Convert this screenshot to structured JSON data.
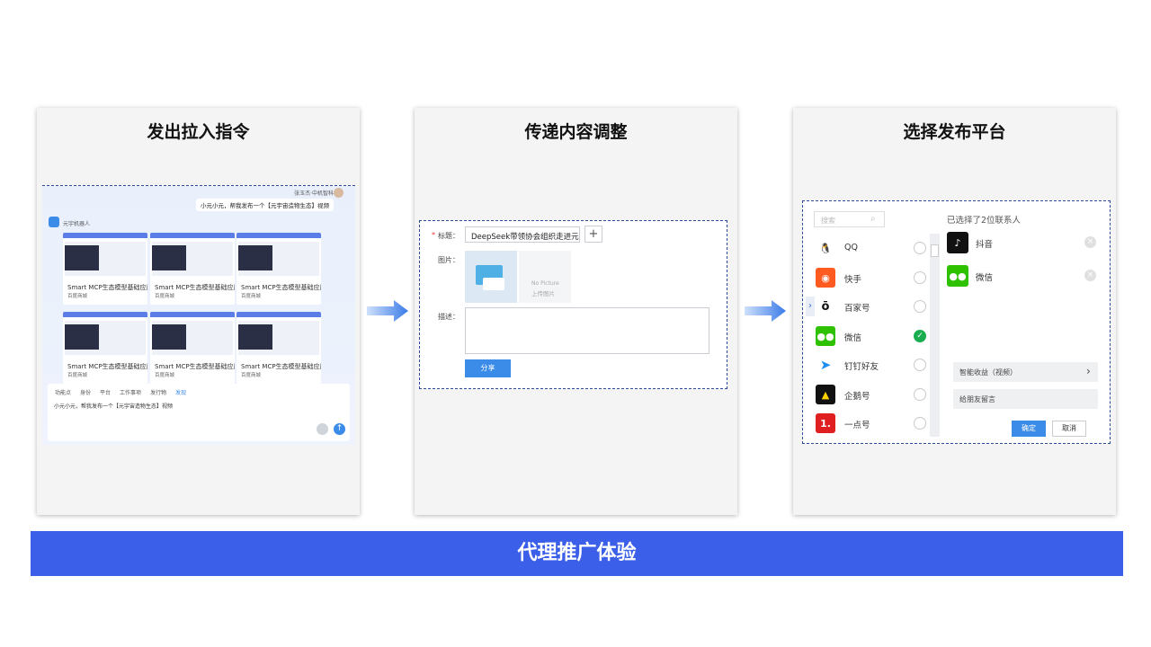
{
  "steps": [
    {
      "title": "发出拉入指令"
    },
    {
      "title": "传递内容调整"
    },
    {
      "title": "选择发布平台"
    }
  ],
  "footer": {
    "title": "代理推广体验"
  },
  "chat": {
    "user_name": "张玉杰·中机智科",
    "user_message": "小元小元，帮我发布一个【元宇宙造物生态】视频",
    "bot_name": "元宇机器人",
    "cards": [
      {
        "title": "Smart MCP生态模型基础应用",
        "author": "百度商城"
      },
      {
        "title": "Smart MCP生态模型基础应用",
        "author": "百度商城"
      },
      {
        "title": "Smart MCP生态模型基础应用",
        "author": "百度商城"
      },
      {
        "title": "Smart MCP生态模型基础应用",
        "author": "百度商城"
      },
      {
        "title": "Smart MCP生态模型基础应用",
        "author": "百度商城"
      },
      {
        "title": "Smart MCP生态模型基础应用",
        "author": "百度商城"
      }
    ],
    "toolbar": [
      "功能点",
      "身份",
      "平台",
      "工作事项",
      "发行物",
      "发现"
    ],
    "compose_text": "小元小元，帮我发布一个【元宇宙造物生态】视频"
  },
  "form": {
    "title_label": "标题：",
    "title_required": "*",
    "title_value": "DeepSeek带领协会组织走进元宇",
    "add_label": "+",
    "image_label": "图片：",
    "no_picture": "No Picture",
    "upload_label": "上传图片",
    "desc_label": "描述：",
    "share_label": "分享"
  },
  "picker": {
    "search_placeholder": "搜索",
    "selected_header": "已选择了2位联系人",
    "platforms": [
      {
        "name": "QQ",
        "icon": "qq-icon",
        "color": "#ffffff",
        "checked": false
      },
      {
        "name": "快手",
        "icon": "kuaishou-icon",
        "color": "#ff5a1f",
        "checked": false
      },
      {
        "name": "百家号",
        "icon": "baijiahao-icon",
        "color": "#ffffff",
        "checked": false
      },
      {
        "name": "微信",
        "icon": "wechat-icon",
        "color": "#2dc100",
        "checked": true
      },
      {
        "name": "钉钉好友",
        "icon": "dingtalk-icon",
        "color": "#ffffff",
        "checked": false
      },
      {
        "name": "企鹅号",
        "icon": "qiehao-icon",
        "color": "#111111",
        "checked": false
      },
      {
        "name": "一点号",
        "icon": "yidianhao-icon",
        "color": "#e02020",
        "checked": false
      }
    ],
    "selected": [
      {
        "name": "抖音",
        "icon": "douyin-icon",
        "color": "#111111"
      },
      {
        "name": "微信",
        "icon": "wechat-icon",
        "color": "#2dc100"
      }
    ],
    "option_earnings": "智能收益（视频）",
    "option_message": "给朋友留言",
    "confirm_label": "确定",
    "cancel_label": "取消"
  },
  "colors": {
    "accent": "#3b5fe8",
    "button": "#3b8be8",
    "check": "#1aad4f"
  }
}
